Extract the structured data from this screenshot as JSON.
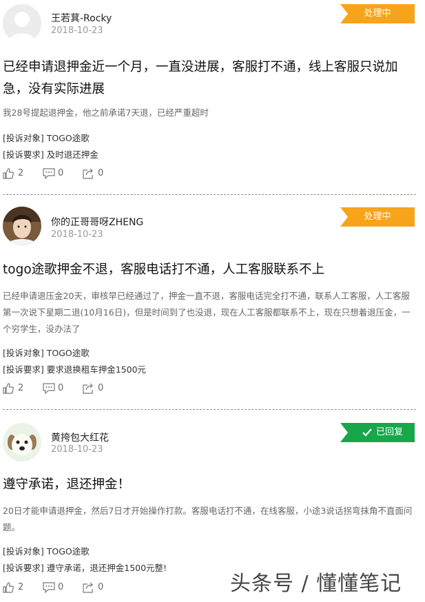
{
  "posts": [
    {
      "user": "王若萁-Rocky",
      "date": "2018-10-23",
      "status": "处理中",
      "title": "已经申请退押金近一个月，一直没进展，客服打不通，线上客服只说加急，没有实际进展",
      "desc": "我28号提起退押金，他之前承诺7天退，已经严重超时",
      "target_label": "[投诉对象]",
      "target": "TOGO途歌",
      "request_label": "[投诉要求]",
      "request": "及时退还押金",
      "likes": "2",
      "comments": "0",
      "shares": "0"
    },
    {
      "user": "你的正哥哥呀ZHENG",
      "date": "2018-10-23",
      "status": "处理中",
      "title": "togo途歌押金不退，客服电话打不通，人工客服联系不上",
      "desc": "已经申请退压金20天，审核早已经通过了，押金一直不退，客服电话完全打不通，联系人工客服，人工客服第一次说下星期二退(10月16日)，但是时间到了也没退，现在人工客服都联系不上，现在只想着退压金，一个穷学生，没办法了",
      "target_label": "[投诉对象]",
      "target": "TOGO途歌",
      "request_label": "[投诉要求]",
      "request": "要求退换租车押金1500元",
      "likes": "2",
      "comments": "0",
      "shares": "0"
    },
    {
      "user": "黄挎包大红花",
      "date": "2018-10-23",
      "status": "已回复",
      "title": "遵守承诺，退还押金！",
      "desc": "20日才能申请退押金，然后7日才开始操作打款。客服电话打不通，在线客服，小途3说话拐弯抹角不直面问题。",
      "target_label": "[投诉对象]",
      "target": "TOGO途歌",
      "request_label": "[投诉要求]",
      "request": "遵守承诺，退还押金1500元整!",
      "likes": "2",
      "comments": "0",
      "shares": "0"
    }
  ],
  "watermark": "头条号 / 懂懂笔记",
  "colors": {
    "processing": "#f8a41a",
    "replied": "#17a74a",
    "date": "#999999",
    "divider": "#8a8a8a"
  },
  "icons": {
    "like": "thumbs-up-icon",
    "comment": "comment-icon",
    "share": "share-icon",
    "check": "check-icon"
  }
}
